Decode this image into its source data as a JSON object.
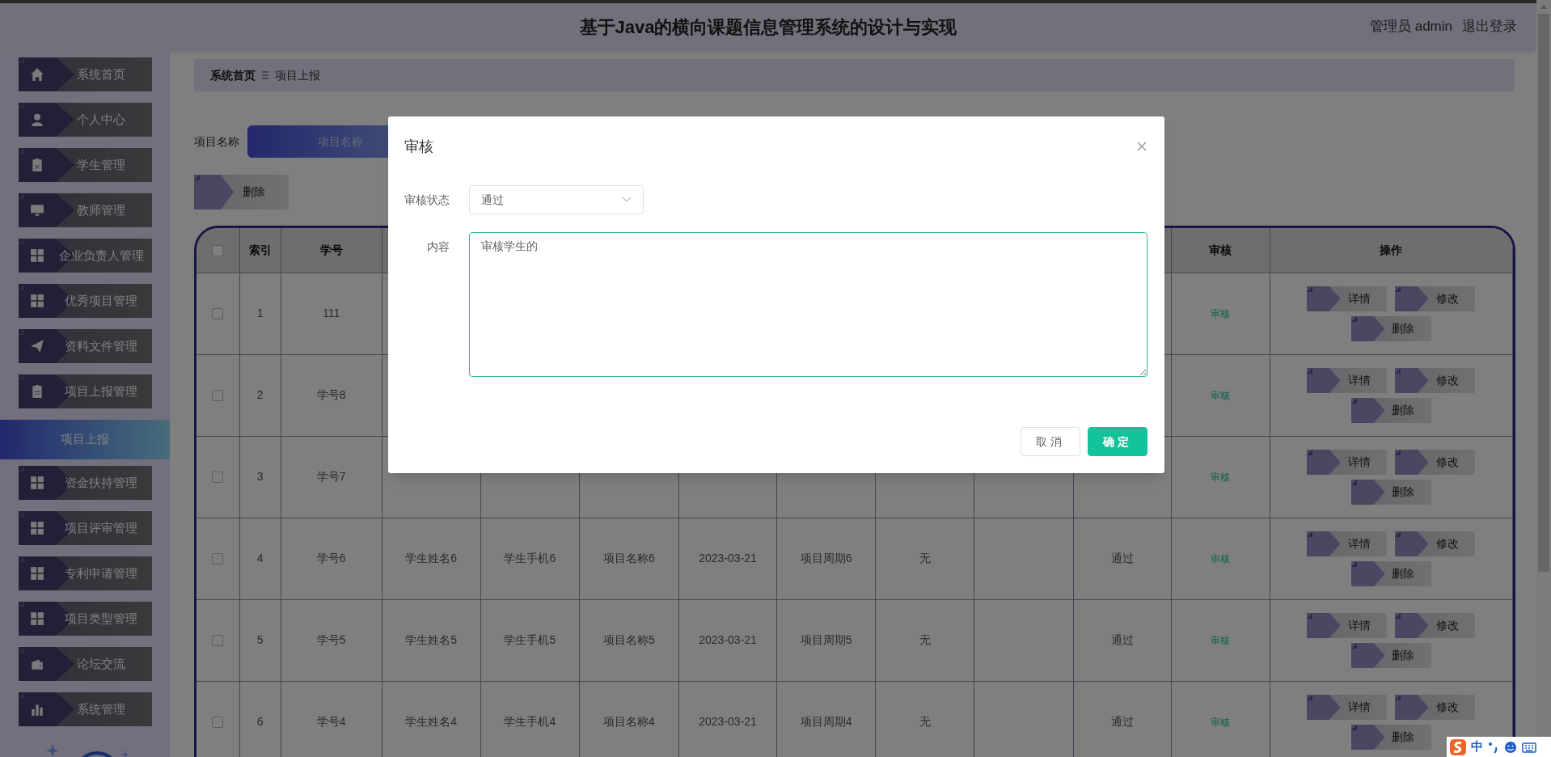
{
  "header": {
    "title": "基于Java的横向课题信息管理系统的设计与实现",
    "user": "管理员 admin",
    "logout": "退出登录"
  },
  "sidebar": {
    "items": [
      {
        "label": "系统首页",
        "selected": false
      },
      {
        "label": "个人中心",
        "selected": false
      },
      {
        "label": "学生管理",
        "selected": false
      },
      {
        "label": "教师管理",
        "selected": false
      },
      {
        "label": "企业负责人管理",
        "selected": false
      },
      {
        "label": "优秀项目管理",
        "selected": false
      },
      {
        "label": "资料文件管理",
        "selected": false
      },
      {
        "label": "项目上报管理",
        "selected": false,
        "children": [
          {
            "label": "项目上报",
            "selected": true
          }
        ]
      },
      {
        "label": "资金扶持管理",
        "selected": false
      },
      {
        "label": "项目评审管理",
        "selected": false
      },
      {
        "label": "专利申请管理",
        "selected": false
      },
      {
        "label": "项目类型管理",
        "selected": false
      },
      {
        "label": "论坛交流",
        "selected": false
      },
      {
        "label": "系统管理",
        "selected": false
      }
    ]
  },
  "breadcrumb": [
    "系统首页",
    "项目上报"
  ],
  "search": {
    "label": "项目名称",
    "placeholder": "项目名称"
  },
  "delete_button": "删除",
  "table": {
    "all_checked": false,
    "header": {
      "index": "索引",
      "student_no": "学号",
      "review": "审核",
      "actions": "操作"
    },
    "rows": [
      {
        "checked": false,
        "index": "1",
        "student_no": "111",
        "review": "审核",
        "actions": [
          "详情",
          "修改",
          "删除"
        ]
      },
      {
        "checked": false,
        "index": "2",
        "student_no": "学号8",
        "review": "审核",
        "actions": [
          "详情",
          "修改",
          "删除"
        ]
      },
      {
        "checked": false,
        "index": "3",
        "student_no": "学号7",
        "review": "审核",
        "actions": [
          "详情",
          "修改",
          "删除"
        ]
      },
      {
        "checked": false,
        "index": "4",
        "student_no": "学号6",
        "column_4": "学生姓名6",
        "column_5": "学生手机6",
        "column_6": "项目名称6",
        "column_7": "2023-03-21",
        "column_8": "项目周期6",
        "column_9": "无",
        "column_11": "通过",
        "review": "审核",
        "actions": [
          "详情",
          "修改",
          "删除"
        ]
      },
      {
        "checked": false,
        "index": "5",
        "student_no": "学号5",
        "column_4": "学生姓名5",
        "column_5": "学生手机5",
        "column_6": "项目名称5",
        "column_7": "2023-03-21",
        "column_8": "项目周期5",
        "column_9": "无",
        "column_11": "通过",
        "review": "审核",
        "actions": [
          "详情",
          "修改",
          "删除"
        ]
      },
      {
        "checked": false,
        "index": "6",
        "student_no": "学号4",
        "column_4": "学生姓名4",
        "column_5": "学生手机4",
        "column_6": "项目名称4",
        "column_7": "2023-03-21",
        "column_8": "项目周期4",
        "column_9": "无",
        "column_11": "通过",
        "review": "审核",
        "actions": [
          "详情",
          "修改",
          "删除"
        ]
      }
    ]
  },
  "dialog": {
    "title": "审核",
    "fields": [
      {
        "kind": "select",
        "label": "审核状态",
        "value": "通过",
        "focused": false
      },
      {
        "kind": "textarea",
        "label": "内容",
        "value": "审核学生的",
        "focused": true
      }
    ],
    "buttons": [
      {
        "kind": "default",
        "label": "取消"
      },
      {
        "kind": "primary",
        "label": "确定"
      }
    ]
  },
  "ime_toolbar": {
    "mode": "中"
  }
}
